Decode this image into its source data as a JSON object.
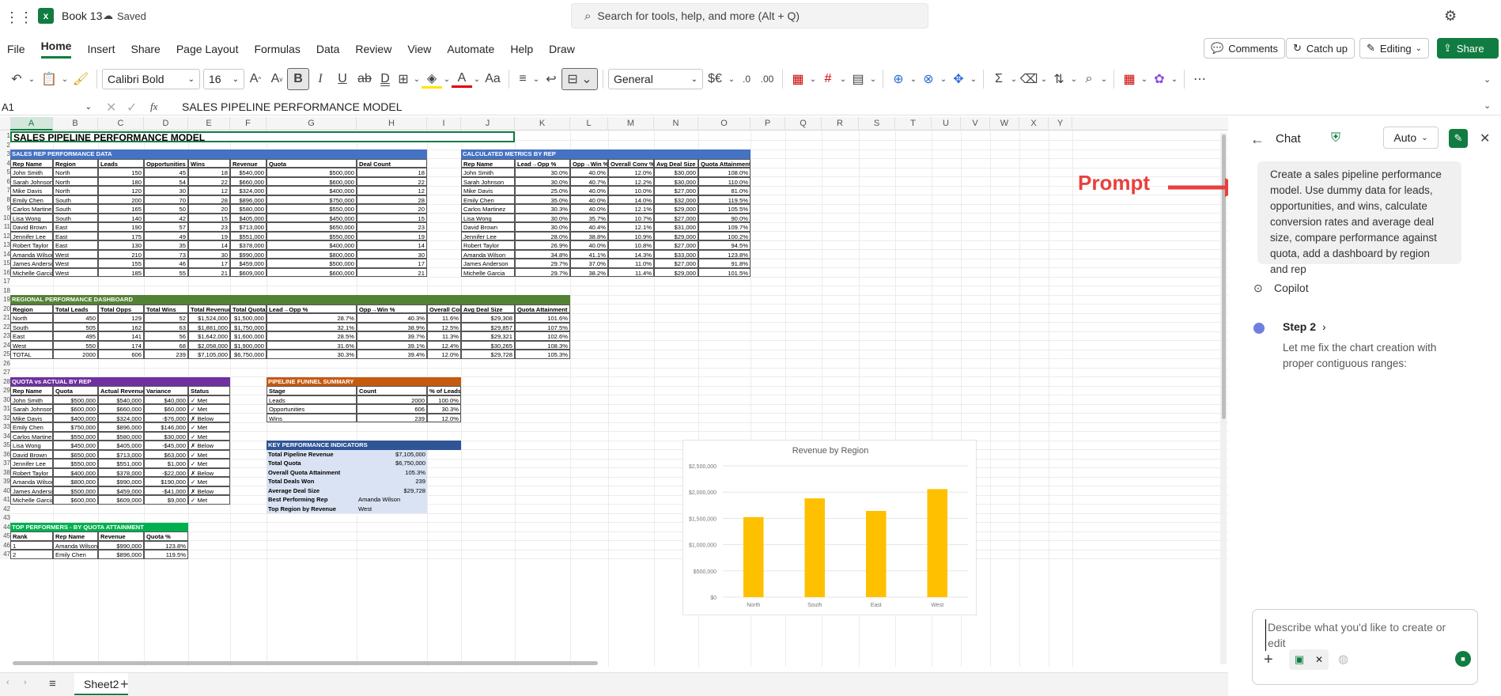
{
  "app": {
    "doc_title": "Book 13",
    "saved": "Saved",
    "search_placeholder": "Search for tools, help, and more (Alt + Q)"
  },
  "menu": [
    "File",
    "Home",
    "Insert",
    "Share",
    "Page Layout",
    "Formulas",
    "Data",
    "Review",
    "View",
    "Automate",
    "Help",
    "Draw"
  ],
  "actions": {
    "comments": "Comments",
    "catchup": "Catch up",
    "editing": "Editing",
    "share": "Share"
  },
  "ribbon": {
    "font": "Calibri Bold",
    "size": "16",
    "format": "General"
  },
  "formula": {
    "namebox": "A1",
    "fx": "fx",
    "content": "SALES PIPELINE PERFORMANCE MODEL"
  },
  "columns": [
    "A",
    "B",
    "C",
    "D",
    "E",
    "F",
    "G",
    "H",
    "I",
    "J",
    "K",
    "L",
    "M",
    "N",
    "O",
    "P",
    "Q",
    "R",
    "S",
    "T",
    "U",
    "V",
    "W",
    "X",
    "Y"
  ],
  "title": "SALES PIPELINE PERFORMANCE MODEL",
  "rep": {
    "header": "SALES REP PERFORMANCE DATA",
    "cols": [
      "Rep Name",
      "Region",
      "Leads",
      "Opportunities",
      "Wins",
      "Revenue",
      "Quota",
      "Deal Count"
    ],
    "rows": [
      [
        "John Smith",
        "North",
        "150",
        "45",
        "18",
        "$540,000",
        "$500,000",
        "18"
      ],
      [
        "Sarah Johnson",
        "North",
        "180",
        "54",
        "22",
        "$660,000",
        "$600,000",
        "22"
      ],
      [
        "Mike Davis",
        "North",
        "120",
        "30",
        "12",
        "$324,000",
        "$400,000",
        "12"
      ],
      [
        "Emily Chen",
        "South",
        "200",
        "70",
        "28",
        "$896,000",
        "$750,000",
        "28"
      ],
      [
        "Carlos Martinez",
        "South",
        "165",
        "50",
        "20",
        "$580,000",
        "$550,000",
        "20"
      ],
      [
        "Lisa Wong",
        "South",
        "140",
        "42",
        "15",
        "$405,000",
        "$450,000",
        "15"
      ],
      [
        "David Brown",
        "East",
        "190",
        "57",
        "23",
        "$713,000",
        "$650,000",
        "23"
      ],
      [
        "Jennifer Lee",
        "East",
        "175",
        "49",
        "19",
        "$551,000",
        "$550,000",
        "19"
      ],
      [
        "Robert Taylor",
        "East",
        "130",
        "35",
        "14",
        "$378,000",
        "$400,000",
        "14"
      ],
      [
        "Amanda Wilson",
        "West",
        "210",
        "73",
        "30",
        "$990,000",
        "$800,000",
        "30"
      ],
      [
        "James Anderson",
        "West",
        "155",
        "46",
        "17",
        "$459,000",
        "$500,000",
        "17"
      ],
      [
        "Michelle Garcia",
        "West",
        "185",
        "55",
        "21",
        "$609,000",
        "$600,000",
        "21"
      ]
    ]
  },
  "calc": {
    "header": "CALCULATED METRICS BY REP",
    "cols": [
      "Rep Name",
      "Lead→Opp %",
      "Opp→Win %",
      "Overall Conv %",
      "Avg Deal Size",
      "Quota Attainment"
    ],
    "rows": [
      [
        "John Smith",
        "30.0%",
        "40.0%",
        "12.0%",
        "$30,000",
        "108.0%"
      ],
      [
        "Sarah Johnson",
        "30.0%",
        "40.7%",
        "12.2%",
        "$30,000",
        "110.0%"
      ],
      [
        "Mike Davis",
        "25.0%",
        "40.0%",
        "10.0%",
        "$27,000",
        "81.0%"
      ],
      [
        "Emily Chen",
        "35.0%",
        "40.0%",
        "14.0%",
        "$32,000",
        "119.5%"
      ],
      [
        "Carlos Martinez",
        "30.3%",
        "40.0%",
        "12.1%",
        "$29,000",
        "105.5%"
      ],
      [
        "Lisa Wong",
        "30.0%",
        "35.7%",
        "10.7%",
        "$27,000",
        "90.0%"
      ],
      [
        "David Brown",
        "30.0%",
        "40.4%",
        "12.1%",
        "$31,000",
        "109.7%"
      ],
      [
        "Jennifer Lee",
        "28.0%",
        "38.8%",
        "10.9%",
        "$29,000",
        "100.2%"
      ],
      [
        "Robert Taylor",
        "26.9%",
        "40.0%",
        "10.8%",
        "$27,000",
        "94.5%"
      ],
      [
        "Amanda Wilson",
        "34.8%",
        "41.1%",
        "14.3%",
        "$33,000",
        "123.8%"
      ],
      [
        "James Anderson",
        "29.7%",
        "37.0%",
        "11.0%",
        "$27,000",
        "91.8%"
      ],
      [
        "Michelle Garcia",
        "29.7%",
        "38.2%",
        "11.4%",
        "$29,000",
        "101.5%"
      ]
    ]
  },
  "region": {
    "header": "REGIONAL PERFORMANCE DASHBOARD",
    "cols": [
      "Region",
      "Total Leads",
      "Total Opps",
      "Total Wins",
      "Total Revenue",
      "Total Quota",
      "Lead→Opp %",
      "Opp→Win %",
      "Overall Conv %",
      "Avg Deal Size",
      "Quota Attainment"
    ],
    "rows": [
      [
        "North",
        "450",
        "129",
        "52",
        "$1,524,000",
        "$1,500,000",
        "28.7%",
        "40.3%",
        "11.6%",
        "$29,308",
        "101.6%"
      ],
      [
        "South",
        "505",
        "162",
        "63",
        "$1,881,000",
        "$1,750,000",
        "32.1%",
        "38.9%",
        "12.5%",
        "$29,857",
        "107.5%"
      ],
      [
        "East",
        "495",
        "141",
        "56",
        "$1,642,000",
        "$1,600,000",
        "28.5%",
        "39.7%",
        "11.3%",
        "$29,321",
        "102.6%"
      ],
      [
        "West",
        "550",
        "174",
        "68",
        "$2,058,000",
        "$1,900,000",
        "31.6%",
        "39.1%",
        "12.4%",
        "$30,265",
        "108.3%"
      ],
      [
        "TOTAL",
        "2000",
        "606",
        "239",
        "$7,105,000",
        "$6,750,000",
        "30.3%",
        "39.4%",
        "12.0%",
        "$29,728",
        "105.3%"
      ]
    ]
  },
  "quota": {
    "header": "QUOTA vs ACTUAL BY REP",
    "cols": [
      "Rep Name",
      "Quota",
      "Actual Revenue",
      "Variance",
      "Status"
    ],
    "rows": [
      [
        "John Smith",
        "$500,000",
        "$540,000",
        "$40,000",
        "✓ Met"
      ],
      [
        "Sarah Johnson",
        "$600,000",
        "$660,000",
        "$60,000",
        "✓ Met"
      ],
      [
        "Mike Davis",
        "$400,000",
        "$324,000",
        "-$76,000",
        "✗ Below"
      ],
      [
        "Emily Chen",
        "$750,000",
        "$896,000",
        "$146,000",
        "✓ Met"
      ],
      [
        "Carlos Martinez",
        "$550,000",
        "$580,000",
        "$30,000",
        "✓ Met"
      ],
      [
        "Lisa Wong",
        "$450,000",
        "$405,000",
        "-$45,000",
        "✗ Below"
      ],
      [
        "David Brown",
        "$650,000",
        "$713,000",
        "$63,000",
        "✓ Met"
      ],
      [
        "Jennifer Lee",
        "$550,000",
        "$551,000",
        "$1,000",
        "✓ Met"
      ],
      [
        "Robert Taylor",
        "$400,000",
        "$378,000",
        "-$22,000",
        "✗ Below"
      ],
      [
        "Amanda Wilson",
        "$800,000",
        "$990,000",
        "$190,000",
        "✓ Met"
      ],
      [
        "James Anderson",
        "$500,000",
        "$459,000",
        "-$41,000",
        "✗ Below"
      ],
      [
        "Michelle Garcia",
        "$600,000",
        "$609,000",
        "$9,000",
        "✓ Met"
      ]
    ]
  },
  "funnel": {
    "header": "PIPELINE FUNNEL SUMMARY",
    "cols": [
      "Stage",
      "Count",
      "% of Leads"
    ],
    "rows": [
      [
        "Leads",
        "2000",
        "100.0%"
      ],
      [
        "Opportunities",
        "606",
        "30.3%"
      ],
      [
        "Wins",
        "239",
        "12.0%"
      ]
    ]
  },
  "kpi": {
    "header": "KEY PERFORMANCE INDICATORS",
    "rows": [
      [
        "Total Pipeline Revenue",
        "$7,105,000"
      ],
      [
        "Total Quota",
        "$6,750,000"
      ],
      [
        "Overall Quota Attainment",
        "105.3%"
      ],
      [
        "Total Deals Won",
        "239"
      ],
      [
        "Average Deal Size",
        "$29,728"
      ],
      [
        "Best Performing Rep",
        "Amanda Wilson"
      ],
      [
        "Top Region by Revenue",
        "West"
      ]
    ]
  },
  "top": {
    "header": "TOP PERFORMERS - BY QUOTA ATTAINMENT",
    "cols": [
      "Rank",
      "Rep Name",
      "Revenue",
      "Quota %"
    ],
    "rows": [
      [
        "1",
        "Amanda Wilson",
        "$990,000",
        "123.8%"
      ],
      [
        "2",
        "Emily Chen",
        "$896,000",
        "119.5%"
      ]
    ]
  },
  "chart_data": {
    "type": "bar",
    "title": "Revenue by Region",
    "categories": [
      "North",
      "South",
      "East",
      "West"
    ],
    "values": [
      1524000,
      1881000,
      1642000,
      2058000
    ],
    "ylim": [
      0,
      2500000
    ],
    "yticks": [
      "$0",
      "$500,000",
      "$1,000,000",
      "$1,500,000",
      "$2,000,000",
      "$2,500,000"
    ],
    "color": "#FFC000"
  },
  "chat": {
    "title": "Chat",
    "mode": "Auto",
    "prompt": "Create a sales pipeline performance model. Use dummy data for leads, opportunities, and wins, calculate conversion rates and average deal size, compare performance against quota, add a dashboard by region and rep",
    "copilot": "Copilot",
    "step": "Step 2",
    "step_text": "Let me fix the chart creation with proper contiguous ranges:",
    "input_placeholder": "Describe what you'd like to create or edit"
  },
  "annotation": "Prompt",
  "sheet_tab": "Sheet2",
  "colors": {
    "blue": "#4472C4",
    "green": "#548235",
    "purple": "#7030A0",
    "orange": "#C55A11",
    "darkblue": "#2F5597",
    "brightgreen": "#00B050",
    "excel_green": "#107C41"
  }
}
